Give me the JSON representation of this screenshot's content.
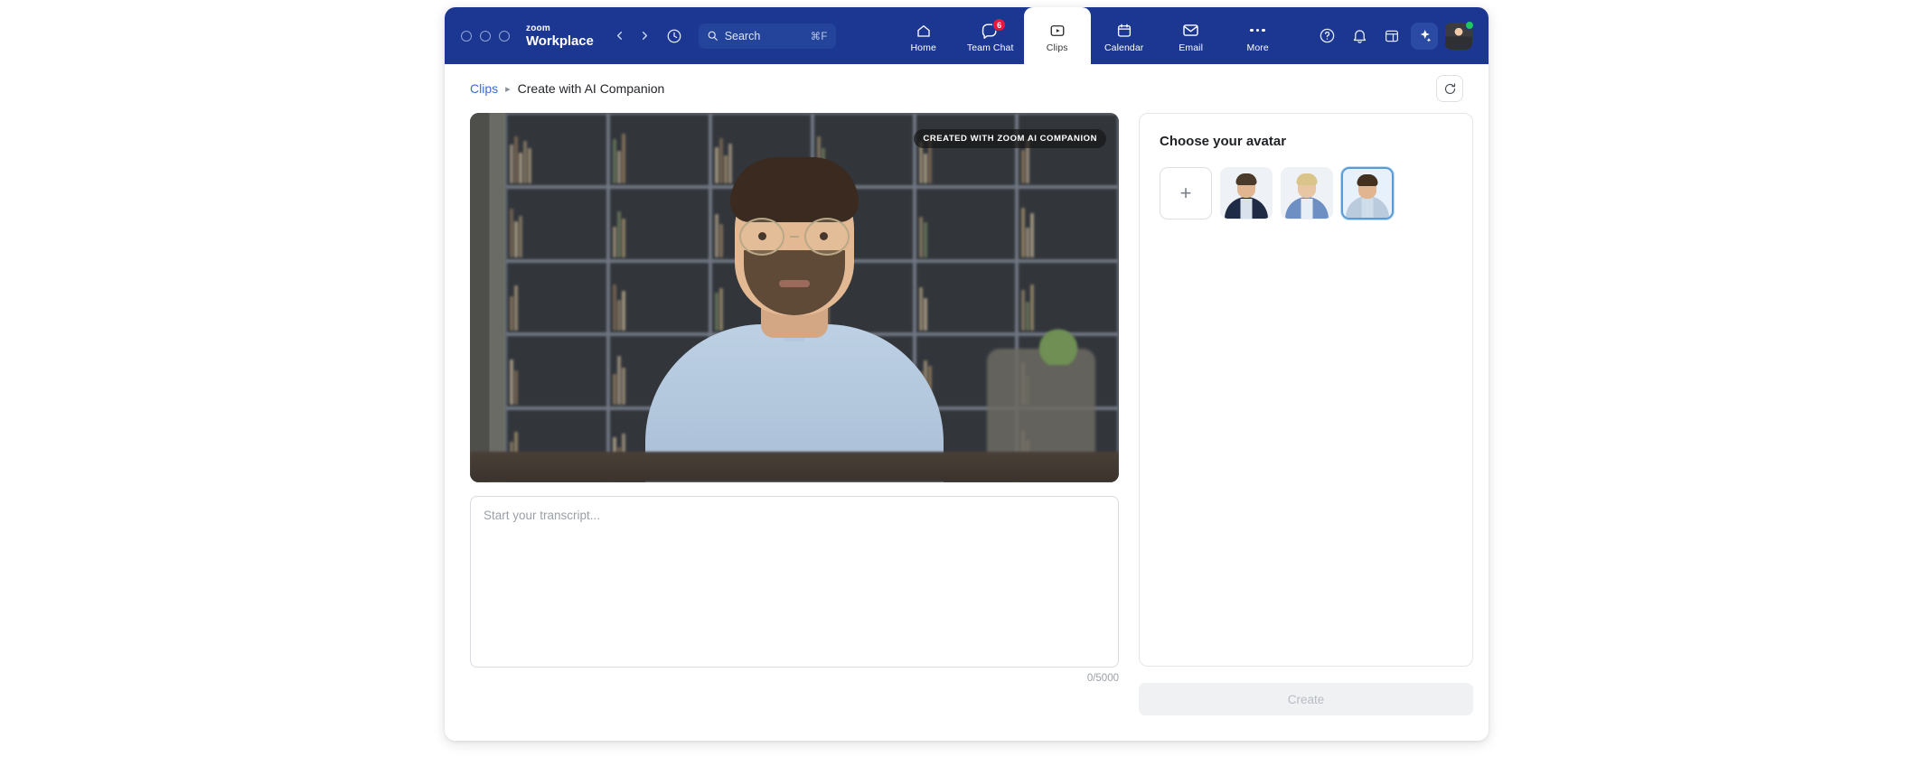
{
  "window": {
    "brand_top": "zoom",
    "brand_bottom": "Workplace",
    "controls": [
      "close",
      "minimize",
      "maximize"
    ]
  },
  "search": {
    "label": "Search",
    "shortcut": "⌘F",
    "icon": "search-icon"
  },
  "nav": {
    "back_icon": "chevron-left-icon",
    "forward_icon": "chevron-right-icon",
    "history_icon": "clock-history-icon"
  },
  "tabs": [
    {
      "label": "Home",
      "icon": "home-icon",
      "active": false,
      "badge": null
    },
    {
      "label": "Team Chat",
      "icon": "chat-icon",
      "active": false,
      "badge": "6"
    },
    {
      "label": "Clips",
      "icon": "clips-icon",
      "active": true,
      "badge": null
    },
    {
      "label": "Calendar",
      "icon": "calendar-icon",
      "active": false,
      "badge": null
    },
    {
      "label": "Email",
      "icon": "email-icon",
      "active": false,
      "badge": null
    },
    {
      "label": "More",
      "icon": "more-dots-icon",
      "active": false,
      "badge": null
    }
  ],
  "header_actions": [
    {
      "name": "help-icon",
      "glyph": "?"
    },
    {
      "name": "notifications-icon",
      "glyph": "bell"
    },
    {
      "name": "apps-window-icon",
      "glyph": "window"
    },
    {
      "name": "ai-companion-icon",
      "glyph": "sparkle"
    }
  ],
  "user": {
    "avatar": "user-avatar",
    "presence": "available",
    "presence_color": "#1ec760"
  },
  "breadcrumb": {
    "parent": "Clips",
    "separator": "▸",
    "current": "Create with AI Companion"
  },
  "refresh": {
    "icon": "refresh-icon",
    "tooltip": "Refresh"
  },
  "video": {
    "watermark": "CREATED WITH ZOOM AI COMPANION",
    "description": "Man with glasses and beard in a light blue shirt seated in front of a bookshelf"
  },
  "transcript": {
    "placeholder": "Start your transcript...",
    "value": "",
    "counter": "0/5000",
    "max_length": 5000
  },
  "avatar_panel": {
    "title": "Choose your avatar",
    "add_label": "+",
    "items": [
      {
        "name": "avatar-option-1",
        "selected": false,
        "skin": "#e0b58f",
        "hair": "#4a3a2c",
        "torso": "#1f2a44",
        "shirt": "#d9e2ec"
      },
      {
        "name": "avatar-option-2",
        "selected": false,
        "skin": "#e8c6a4",
        "hair": "#d9c48a",
        "torso": "#6d8fc4",
        "shirt": "#e8eef6"
      },
      {
        "name": "avatar-option-3",
        "selected": true,
        "skin": "#e0b58f",
        "hair": "#43301f",
        "torso": "#b9cbdd",
        "shirt": "#cfdcea"
      }
    ]
  },
  "create_button": {
    "label": "Create",
    "disabled": true
  },
  "colors": {
    "header_blue": "#1b3791",
    "accent_blue": "#3a6dd0",
    "selection_blue": "#5b9bd5",
    "badge_red": "#e8173d"
  }
}
